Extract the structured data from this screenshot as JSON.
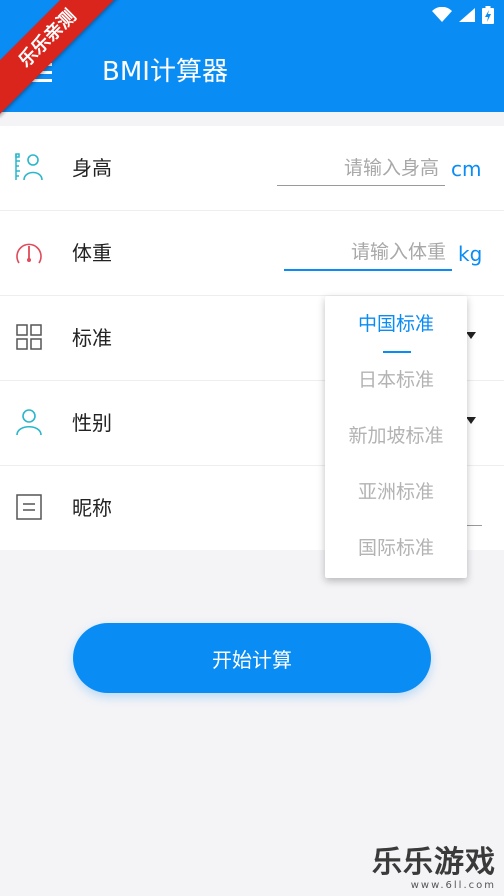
{
  "ribbon": {
    "text": "乐乐亲测"
  },
  "appbar": {
    "title": "BMI计算器",
    "menu_icon": "hamburger-menu-icon"
  },
  "status_icons": [
    "wifi-icon",
    "signal-icon",
    "battery-charging-icon"
  ],
  "form": {
    "height": {
      "label": "身高",
      "placeholder": "请输入身高",
      "unit": "cm",
      "icon": "person-height-icon"
    },
    "weight": {
      "label": "体重",
      "placeholder": "请输入体重",
      "unit": "kg",
      "icon": "gauge-icon"
    },
    "standard": {
      "label": "标准",
      "icon": "grid-icon"
    },
    "gender": {
      "label": "性别",
      "icon": "person-icon"
    },
    "nickname": {
      "label": "昵称",
      "icon": "note-icon"
    }
  },
  "dropdown": {
    "options": [
      "中国标准",
      "日本标准",
      "新加坡标准",
      "亚洲标准",
      "国际标准"
    ],
    "selected": "中国标准"
  },
  "calculate_button": {
    "label": "开始计算"
  },
  "watermark": {
    "text": "乐乐游戏",
    "url": "www.6ll.com"
  },
  "colors": {
    "primary": "#0a8cf5",
    "ribbon": "#d9251c",
    "icon_teal": "#2ab7c9",
    "icon_red": "#e04a5a"
  }
}
